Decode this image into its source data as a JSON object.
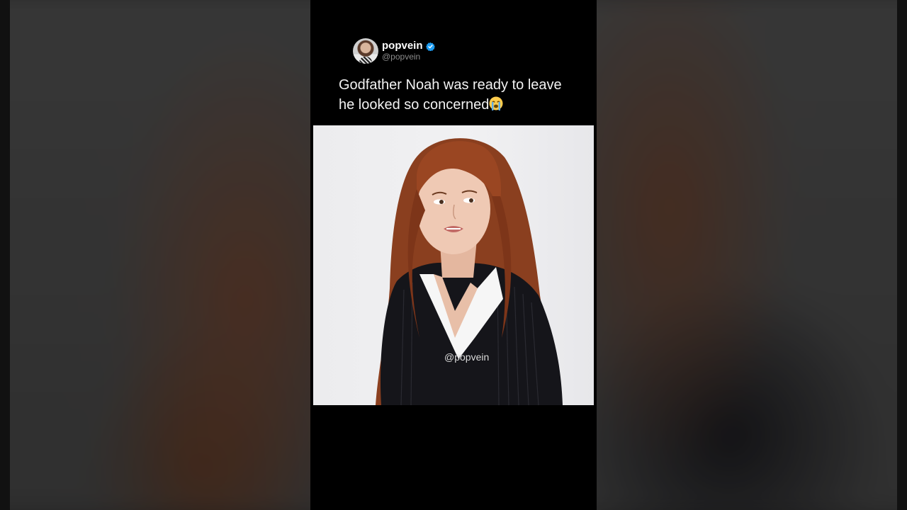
{
  "post": {
    "display_name": "popvein",
    "handle": "@popvein",
    "verified": true,
    "text_line1": "Godfather Noah was ready to leave",
    "text_line2": "he looked so concerned",
    "emoji": "loudly-crying-face"
  },
  "media": {
    "watermark": "@popvein"
  },
  "colors": {
    "frame_background": "#000000",
    "verified_blue": "#1d9bf0",
    "page_background": "#3f3f3f"
  }
}
